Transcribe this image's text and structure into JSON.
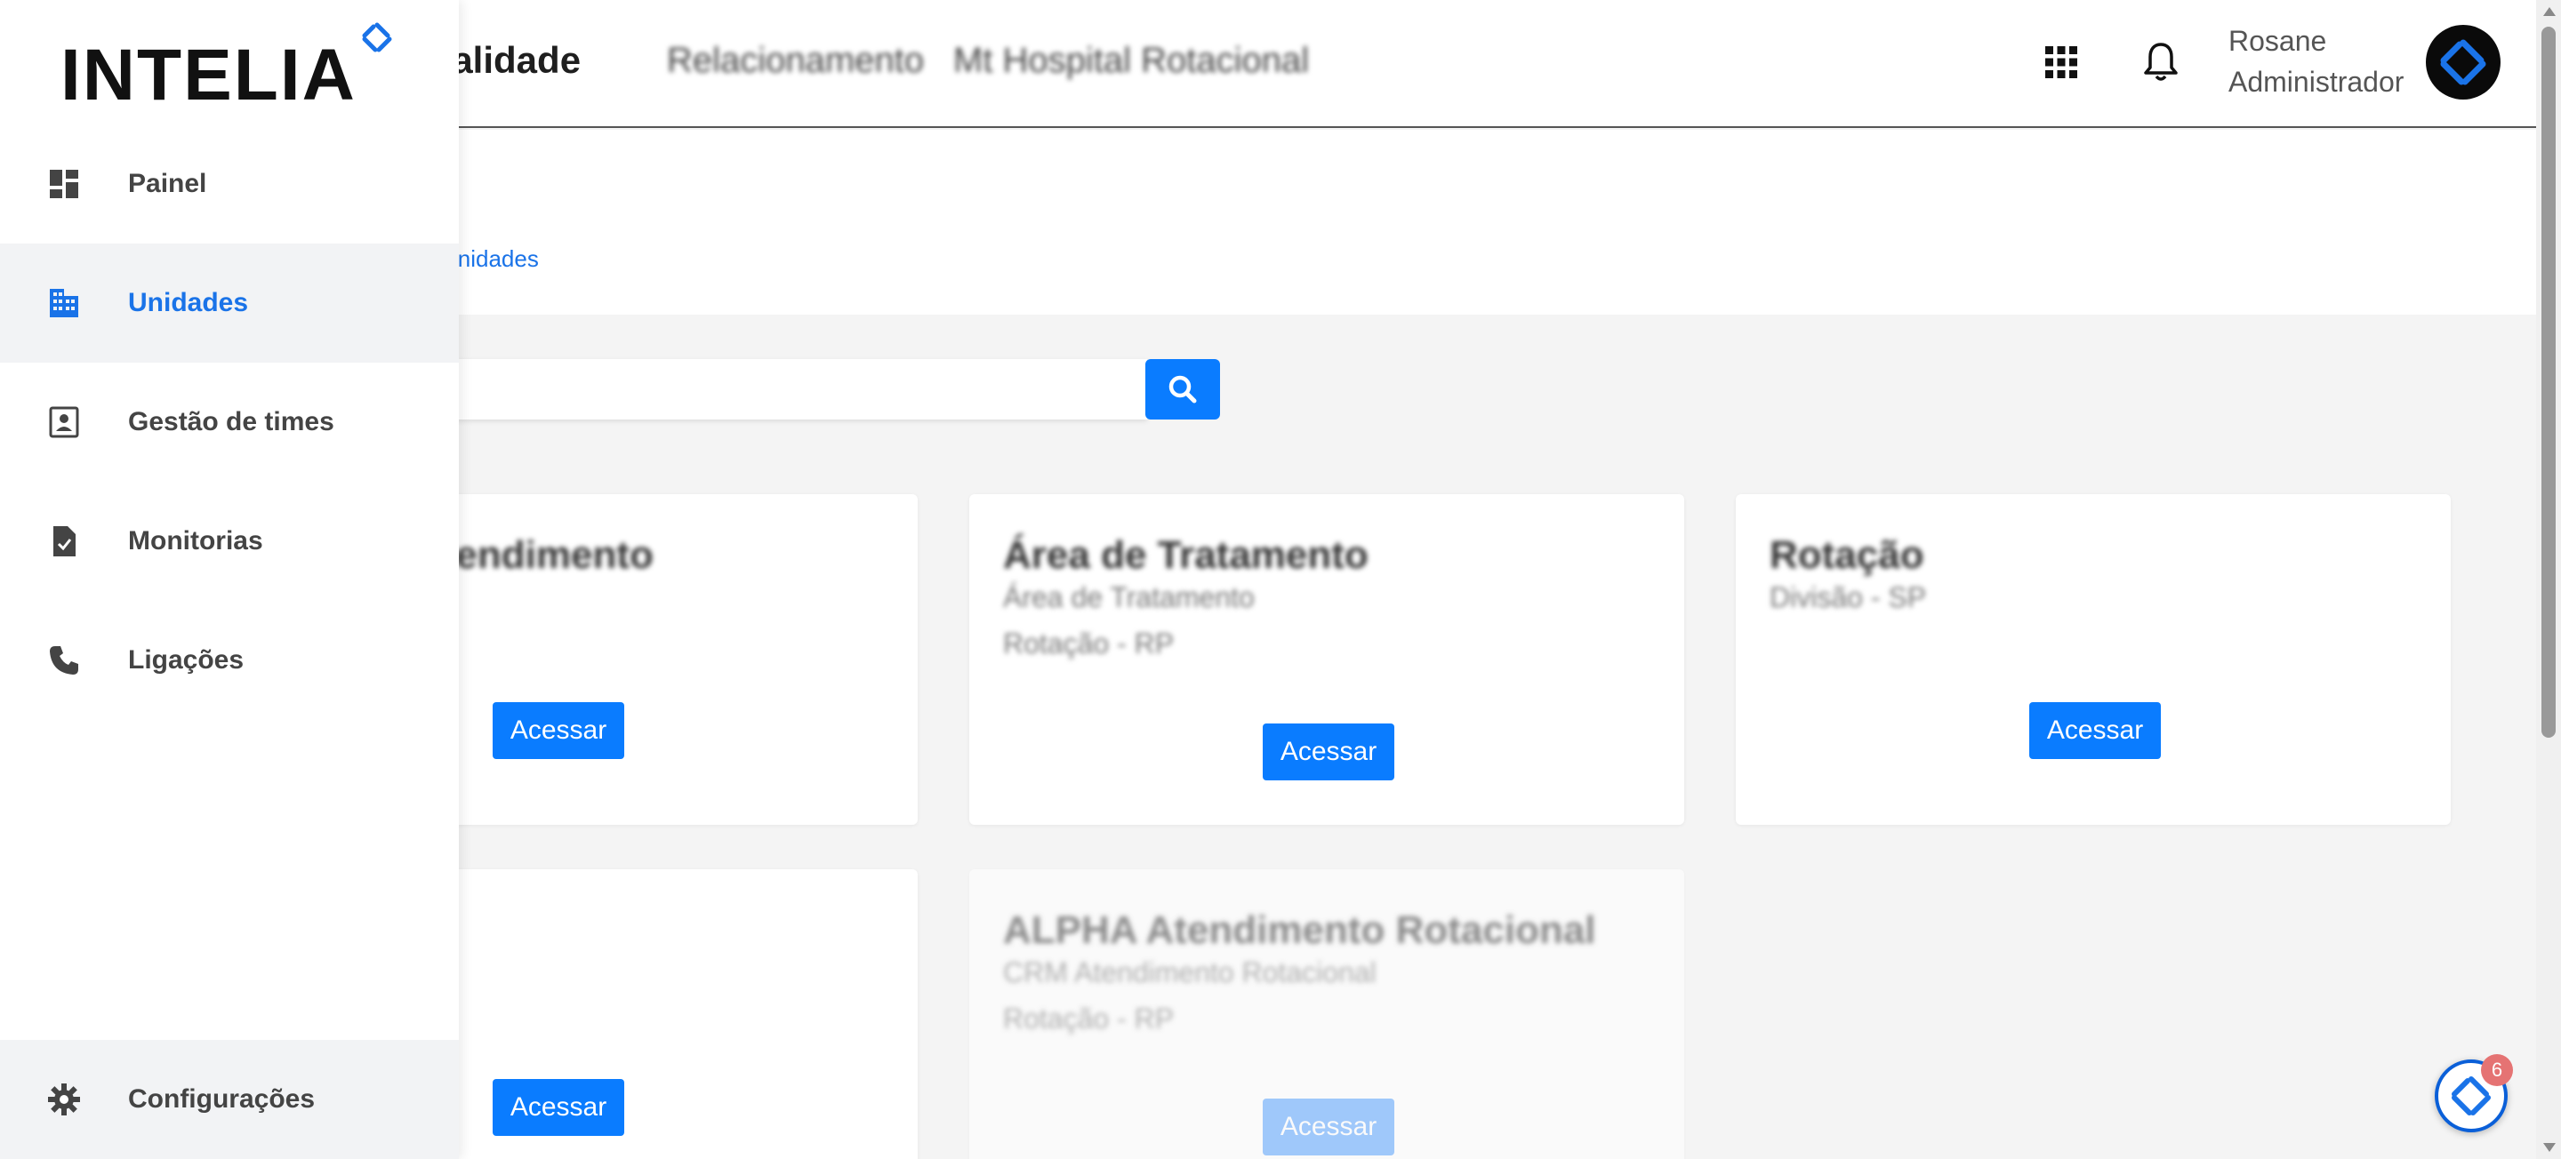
{
  "header": {
    "title": "Qualidade",
    "blur1": "Relacionamento",
    "blur2": "Mt Hospital Rotacional",
    "user_name": "Rosane",
    "user_role": "Administrador"
  },
  "breadcrumb": "Unidades",
  "search": {
    "placeholder": ""
  },
  "sidebar": {
    "logo": "INTELIA",
    "items": [
      {
        "label": "Painel",
        "icon": "dashboard-icon"
      },
      {
        "label": "Unidades",
        "icon": "building-icon",
        "active": true
      },
      {
        "label": "Gestão de times",
        "icon": "contact-card-icon"
      },
      {
        "label": "Monitorias",
        "icon": "document-check-icon"
      },
      {
        "label": "Ligações",
        "icon": "phone-icon"
      }
    ],
    "footer": {
      "label": "Configurações",
      "icon": "gear-icon"
    }
  },
  "cards": [
    {
      "line1": "Atendimento",
      "line2": "",
      "line3": "",
      "button": "Acessar"
    },
    {
      "line1": "Área de Tratamento",
      "line2": "Área de Tratamento",
      "line3": "Rotação - RP",
      "button": "Acessar"
    },
    {
      "line1": "Rotação",
      "line2": "Divisão - SP",
      "line3": "",
      "button": "Acessar"
    },
    {
      "line1": "",
      "line2": "",
      "line3": "",
      "button": "Acessar"
    },
    {
      "line1": "ALPHA Atendimento Rotacional",
      "line2": "CRM Atendimento Rotacional",
      "line3": "Rotação - RP",
      "button": "Acessar"
    }
  ],
  "chat": {
    "badge": "6"
  },
  "colors": {
    "accent": "#0a7cff",
    "link": "#1a73e8",
    "badge": "#e57373"
  }
}
